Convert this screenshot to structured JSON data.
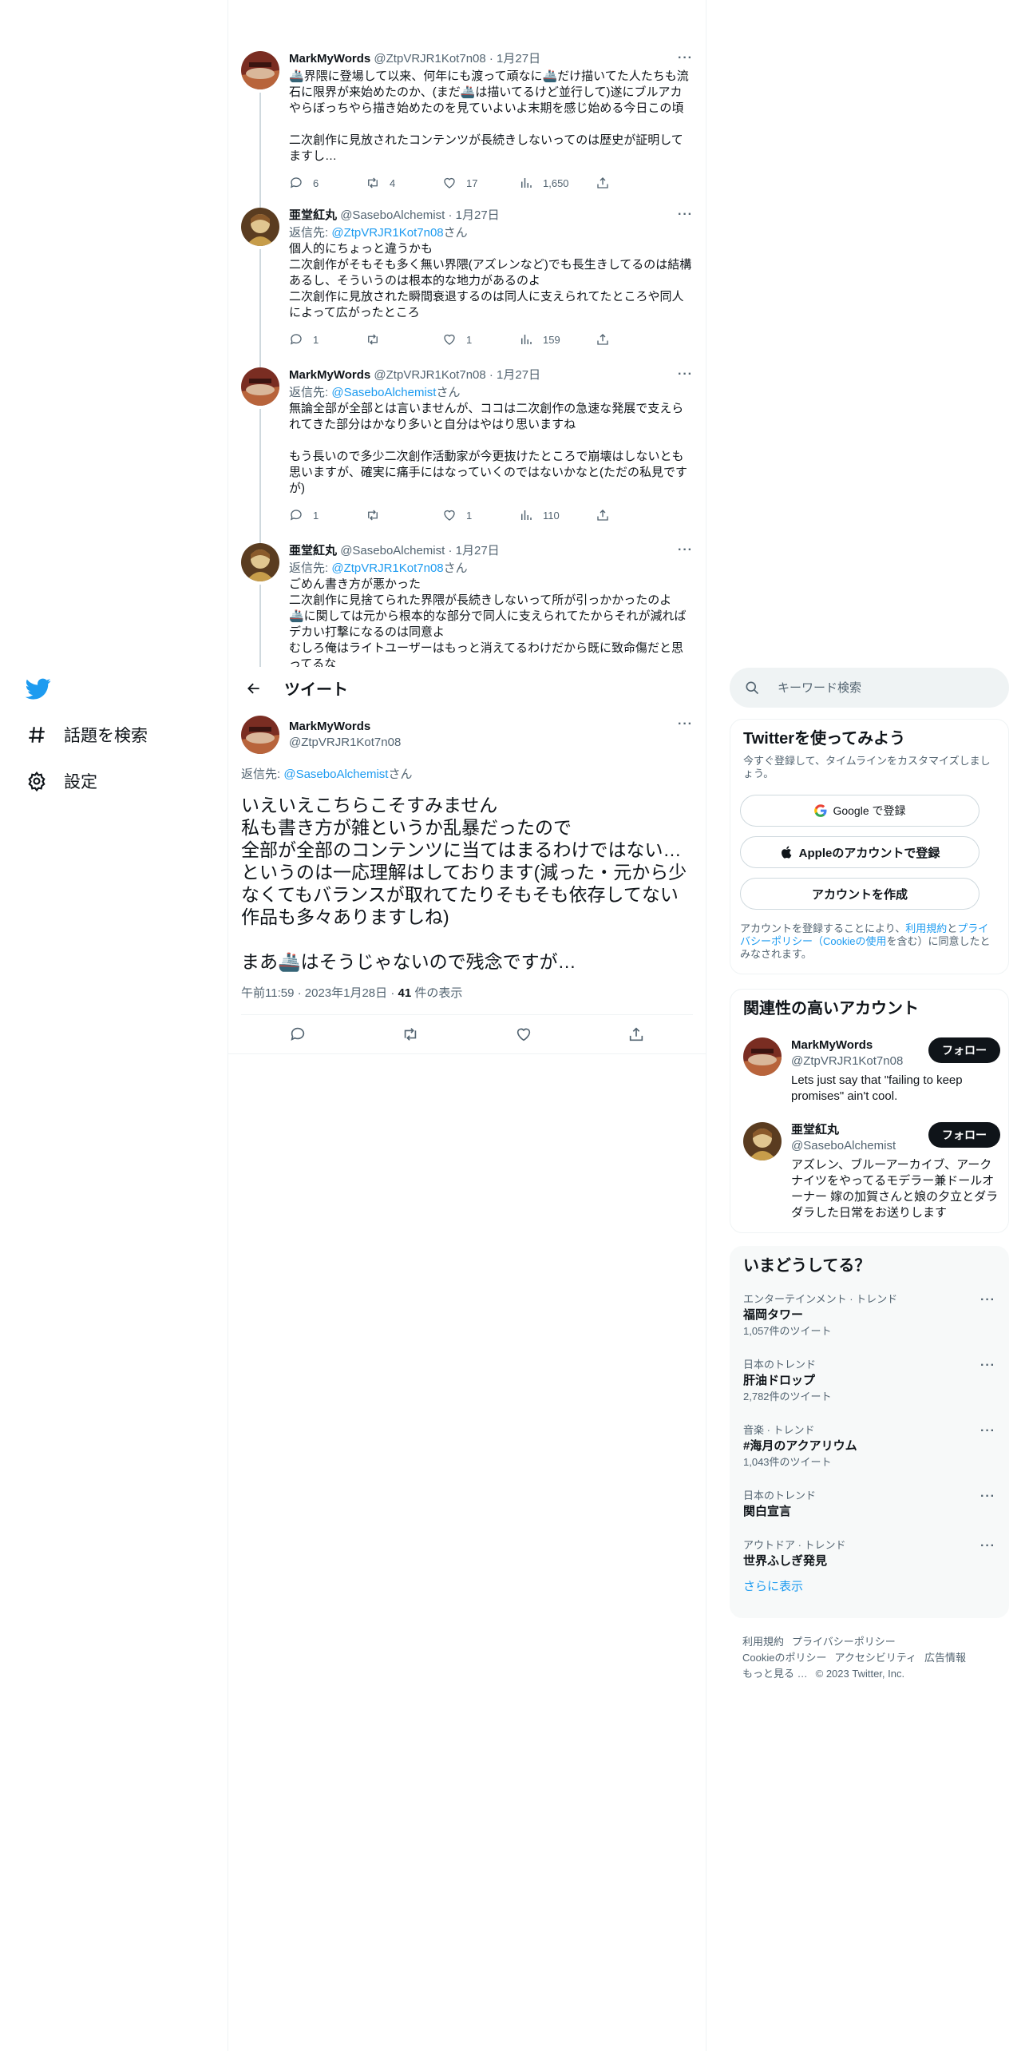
{
  "nav": {
    "explore_label": "話題を検索",
    "settings_label": "設定"
  },
  "thread": [
    {
      "name": "MarkMyWords",
      "meta": "@ZtpVRJR1Kot7n08 · 1月27日",
      "reply_prefix": "",
      "reply_handle": "",
      "reply_suffix": "",
      "text": "🚢界隈に登場して以来、何年にも渡って頑なに🚢だけ描いてた人たちも流石に限界が来始めたのか、(まだ🚢は描いてるけど並行して)遂にブルアカやらぼっちやら描き始めたのを見ていよいよ末期を感じ始める今日この頃\n\n二次創作に見放されたコンテンツが長続きしないってのは歴史が証明してますし…",
      "replies": "6",
      "retweets": "4",
      "likes": "17",
      "views": "1,650"
    },
    {
      "name": "亜堂紅丸",
      "meta": "@SaseboAlchemist · 1月27日",
      "reply_prefix": "返信先: ",
      "reply_handle": "@ZtpVRJR1Kot7n08",
      "reply_suffix": "さん",
      "text": "個人的にちょっと違うかも\n二次創作がそもそも多く無い界隈(アズレンなど)でも長生きしてるのは結構あるし、そういうのは根本的な地力があるのよ\n二次創作に見放された瞬間衰退するのは同人に支えられてたところや同人によって広がったところ",
      "replies": "1",
      "retweets": "",
      "likes": "1",
      "views": "159"
    },
    {
      "name": "MarkMyWords",
      "meta": "@ZtpVRJR1Kot7n08 · 1月27日",
      "reply_prefix": "返信先: ",
      "reply_handle": "@SaseboAlchemist",
      "reply_suffix": "さん",
      "text": "無論全部が全部とは言いませんが、ココは二次創作の急速な発展で支えられてきた部分はかなり多いと自分はやはり思いますね\n\nもう長いので多少二次創作活動家が今更抜けたところで崩壊はしないとも思いますが、確実に痛手にはなっていくのではないかなと(ただの私見ですが)",
      "replies": "1",
      "retweets": "",
      "likes": "1",
      "views": "110"
    },
    {
      "name": "亜堂紅丸",
      "meta": "@SaseboAlchemist · 1月27日",
      "reply_prefix": "返信先: ",
      "reply_handle": "@ZtpVRJR1Kot7n08",
      "reply_suffix": "さん",
      "text": "ごめん書き方が悪かった\n二次創作に見捨てられた界隈が長続きしないって所が引っかかったのよ\n🚢に関しては元から根本的な部分で同人に支えられてたからそれが減れば デカい打撃になるのは同意よ\nむしろ俺はライトユーザーはもっと消えてるわけだから既に致命傷だと思ってるな",
      "replies": "",
      "retweets": "",
      "likes": "",
      "views": ""
    }
  ],
  "header": {
    "title": "ツイート"
  },
  "main_tweet": {
    "name": "MarkMyWords",
    "handle": "@ZtpVRJR1Kot7n08",
    "reply_prefix": "返信先: ",
    "reply_handle": "@SaseboAlchemist",
    "reply_suffix": "さん",
    "text": "いえいえこちらこそすみません\n私も書き方が雑というか乱暴だったので\n全部が全部のコンテンツに当てはまるわけではない…というのは一応理解はしております(減った・元から少なくてもバランスが取れてたりそもそも依存してない作品も多々ありますしね)\n\nまあ🚢はそうじゃないので残念ですが…",
    "time": "午前11:59 · 2023年1月28日 · ",
    "views": "41",
    "views_label": " 件の表示"
  },
  "search": {
    "placeholder": "キーワード検索"
  },
  "signup": {
    "title": "Twitterを使ってみよう",
    "subtitle": "今すぐ登録して、タイムラインをカスタマイズしましょう。",
    "google_label": "Google で登録",
    "apple_label": "Appleのアカウントで登録",
    "create_label": "アカウントを作成",
    "legal_1": "アカウントを登録することにより、",
    "legal_terms": "利用規約",
    "legal_2": "と",
    "legal_privacy": "プライバシーポリシー（Cookieの使用",
    "legal_3": "を含む）に同意したとみなされます。"
  },
  "related": {
    "title": "関連性の高いアカウント",
    "follow_label": "フォロー",
    "accounts": [
      {
        "name": "MarkMyWords",
        "handle": "@ZtpVRJR1Kot7n08",
        "bio": "Lets just say that \"failing to keep promises\" ain't cool."
      },
      {
        "name": "亜堂紅丸",
        "handle": "@SaseboAlchemist",
        "bio": "アズレン、ブルーアーカイブ、アークナイツをやってるモデラー兼ドールオーナー 嫁の加賀さんと娘の夕立とダラダラした日常をお送りします"
      }
    ]
  },
  "trends": {
    "title": "いまどうしてる？",
    "items": [
      {
        "category": "エンターテインメント · トレンド",
        "name": "福岡タワー",
        "count": "1,057件のツイート"
      },
      {
        "category": "日本のトレンド",
        "name": "肝油ドロップ",
        "count": "2,782件のツイート"
      },
      {
        "category": "音楽 · トレンド",
        "name": "#海月のアクアリウム",
        "count": "1,043件のツイート"
      },
      {
        "category": "日本のトレンド",
        "name": "関白宣言",
        "count": ""
      },
      {
        "category": "アウトドア · トレンド",
        "name": "世界ふしぎ発見",
        "count": ""
      }
    ],
    "show_more": "さらに表示"
  },
  "footer": {
    "terms": "利用規約",
    "privacy": "プライバシーポリシー",
    "cookie": "Cookieのポリシー",
    "accessibility": "アクセシビリティ",
    "ads": "広告情報",
    "more": "もっと見る …",
    "copyright": "© 2023 Twitter, Inc."
  },
  "colors": {
    "accent": "#1d9bf0",
    "text": "#0f1419",
    "muted": "#536471",
    "border": "#eff3f4"
  }
}
